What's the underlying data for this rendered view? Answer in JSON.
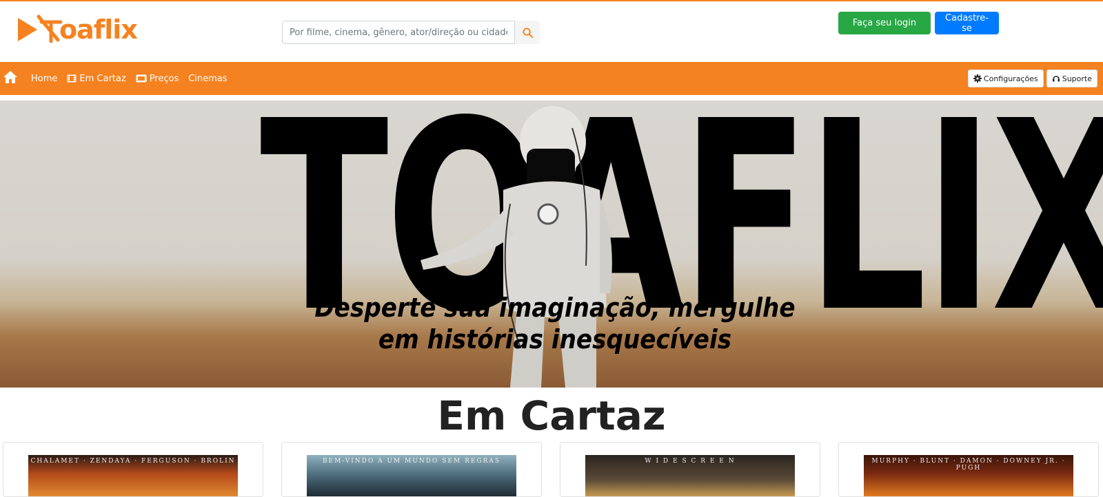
{
  "brand": {
    "logo_text": "oaflix",
    "accent": "#f58220"
  },
  "search": {
    "placeholder": "Por filme, cinema, gênero, ator/direção ou cidade",
    "icon": "search-icon"
  },
  "auth": {
    "login_label": "Faça seu login",
    "signup_label": "Cadastre-se",
    "login_color": "#28a745",
    "signup_color": "#007bff"
  },
  "nav": {
    "home_icon": "home-icon",
    "items": [
      {
        "label": "Home",
        "icon": ""
      },
      {
        "label": "Em Cartaz",
        "icon": "film-icon"
      },
      {
        "label": "Preços",
        "icon": "ticket-icon"
      },
      {
        "label": "Cinemas",
        "icon": ""
      }
    ],
    "settings_label": "Configurações",
    "support_label": "Suporte"
  },
  "hero": {
    "title": "TOAFLIX",
    "tagline": "Desperte sua imaginação, mergulhe em histórias inesquecíveis"
  },
  "section": {
    "title": "Em Cartaz"
  },
  "movies": [
    {
      "poster_text": "CHALAMET · ZENDAYA · FERGUSON · BROLIN",
      "poster_color": "#b34a1a"
    },
    {
      "poster_text": "BEM-VINDO A UM MUNDO SEM REGRAS",
      "poster_color": "#4b6a7a"
    },
    {
      "poster_text": "W I D E S C R E E N",
      "poster_color": "#5a4a38"
    },
    {
      "poster_text": "MURPHY · BLUNT · DAMON · DOWNEY JR. · PUGH",
      "poster_color": "#7a2a10"
    }
  ]
}
